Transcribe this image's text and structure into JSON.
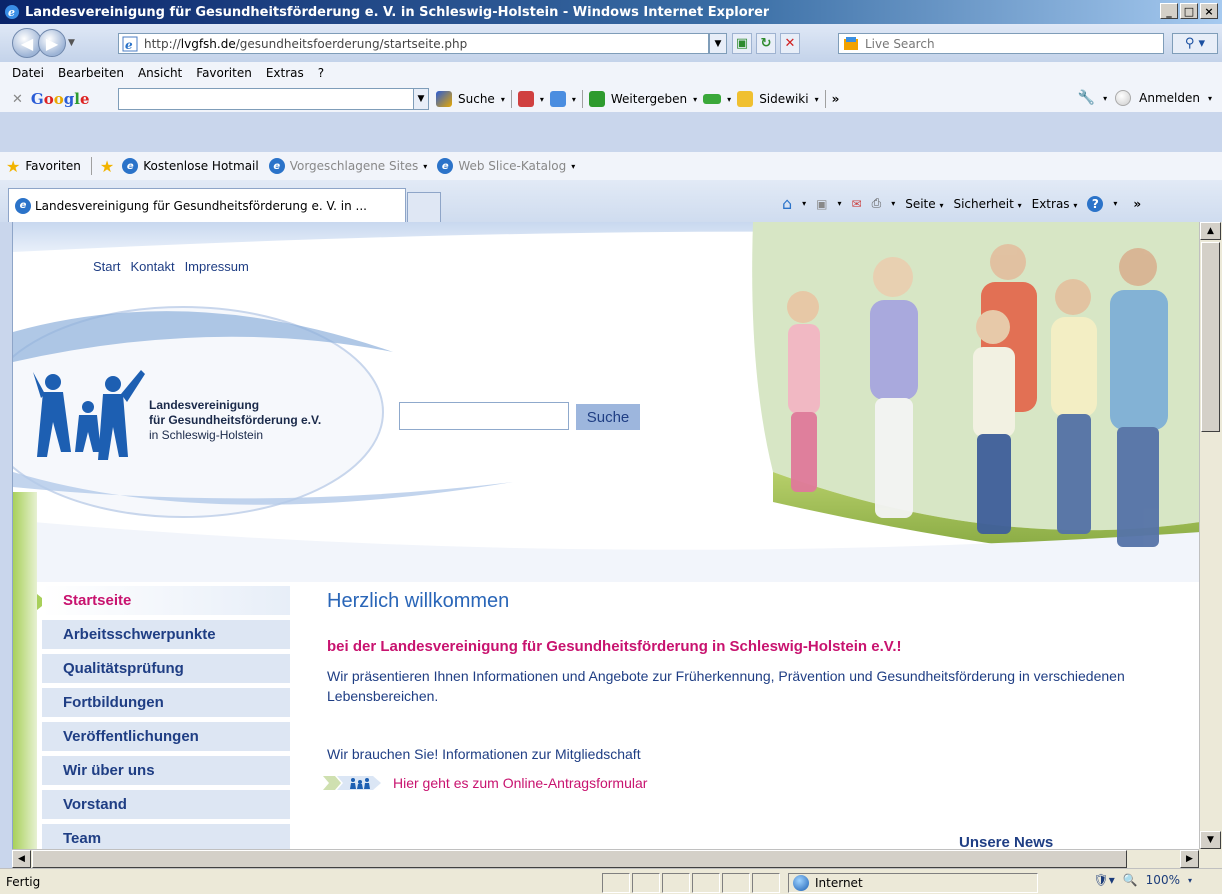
{
  "window": {
    "title": "Landesvereinigung für Gesundheitsförderung e. V. in Schleswig-Holstein - Windows Internet Explorer",
    "min": "_",
    "max": "□",
    "close": "×"
  },
  "address": {
    "url_prefix": "http://",
    "url_host": "lvgfsh.de",
    "url_path": "/gesundheitsfoerderung/startseite.php",
    "live_search_placeholder": "Live Search"
  },
  "menu": [
    "Datei",
    "Bearbeiten",
    "Ansicht",
    "Favoriten",
    "Extras",
    "?"
  ],
  "google_toolbar": {
    "logo": "Google",
    "search_label": "Suche",
    "share_label": "Weitergeben",
    "sidewiki_label": "Sidewiki",
    "more": "»",
    "signin_label": "Anmelden"
  },
  "favorites": {
    "label": "Favoriten",
    "items": [
      "Kostenlose Hotmail",
      "Vorgeschlagene Sites",
      "Web Slice-Katalog"
    ]
  },
  "tabs": {
    "active": "Landesvereinigung für Gesundheitsförderung e. V. in ..."
  },
  "command_bar": [
    "Seite",
    "Sicherheit",
    "Extras"
  ],
  "page": {
    "top_links": [
      "Start",
      "Kontakt",
      "Impressum"
    ],
    "logo_line1": "Landesvereinigung",
    "logo_line2": "für Gesundheitsförderung e.V.",
    "logo_line3": "in Schleswig-Holstein",
    "search_button": "Suche",
    "nav": [
      "Startseite",
      "Arbeitsschwerpunkte",
      "Qualitätsprüfung",
      "Fortbildungen",
      "Veröffentlichungen",
      "Wir über uns",
      "Vorstand",
      "Team"
    ],
    "welcome": "Herzlich willkommen",
    "subtitle": "bei der Landesvereinigung für Gesundheitsförderung in Schleswig-Holstein e.V.!",
    "intro": "Wir präsentieren Ihnen Informationen und Angebote zur Früherkennung, Prävention und Gesundheitsförderung in verschiedenen Lebensbereichen.",
    "membership": "Wir brauchen Sie! Informationen zur Mitgliedschaft",
    "form_link": "Hier geht es zum Online-Antragsformular",
    "news_heading": "Unsere News"
  },
  "status": {
    "text": "Fertig",
    "zone": "Internet",
    "zoom": "100%"
  },
  "colors": {
    "accent_pink": "#c8136f",
    "nav_blue": "#1f3e84",
    "heading_blue": "#2a66b8",
    "green_stripe": "#a8d05a"
  }
}
